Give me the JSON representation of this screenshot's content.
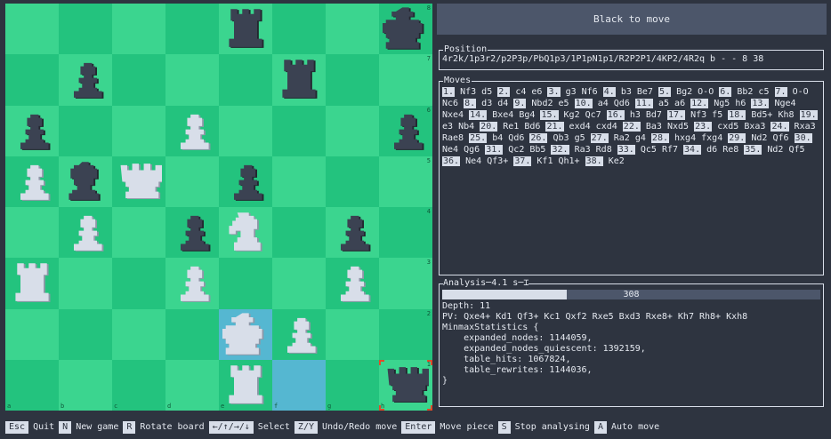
{
  "status": "Black to move",
  "position": {
    "title": "Position",
    "fen": "4r2k/1p3r2/p2P3p/PbQ1p3/1P1pN1p1/R2P2P1/4KP2/4R2q b - - 8 38"
  },
  "moves": {
    "title": "Moves",
    "list": [
      {
        "n": "1.",
        "w": "Nf3",
        "b": "d5"
      },
      {
        "n": "2.",
        "w": "c4",
        "b": "e6"
      },
      {
        "n": "3.",
        "w": "g3",
        "b": "Nf6"
      },
      {
        "n": "4.",
        "w": "b3",
        "b": "Be7"
      },
      {
        "n": "5.",
        "w": "Bg2",
        "b": "O-O"
      },
      {
        "n": "6.",
        "w": "Bb2",
        "b": "c5"
      },
      {
        "n": "7.",
        "w": "O-O",
        "b": "Nc6"
      },
      {
        "n": "8.",
        "w": "d3",
        "b": "d4"
      },
      {
        "n": "9.",
        "w": "Nbd2",
        "b": "e5"
      },
      {
        "n": "10.",
        "w": "a4",
        "b": "Qd6"
      },
      {
        "n": "11.",
        "w": "a5",
        "b": "a6"
      },
      {
        "n": "12.",
        "w": "Ng5",
        "b": "h6"
      },
      {
        "n": "13.",
        "w": "Nge4",
        "b": "Nxe4"
      },
      {
        "n": "14.",
        "w": "Bxe4",
        "b": "Bg4"
      },
      {
        "n": "15.",
        "w": "Kg2",
        "b": "Qc7"
      },
      {
        "n": "16.",
        "w": "h3",
        "b": "Bd7"
      },
      {
        "n": "17.",
        "w": "Nf3",
        "b": "f5"
      },
      {
        "n": "18.",
        "w": "Bd5+",
        "b": "Kh8"
      },
      {
        "n": "19.",
        "w": "e3",
        "b": "Nb4"
      },
      {
        "n": "20.",
        "w": "Re1",
        "b": "Bd6"
      },
      {
        "n": "21.",
        "w": "exd4",
        "b": "cxd4"
      },
      {
        "n": "22.",
        "w": "Ba3",
        "b": "Nxd5"
      },
      {
        "n": "23.",
        "w": "cxd5",
        "b": "Bxa3"
      },
      {
        "n": "24.",
        "w": "Rxa3",
        "b": "Rae8"
      },
      {
        "n": "25.",
        "w": "b4",
        "b": "Qd6"
      },
      {
        "n": "26.",
        "w": "Qb3",
        "b": "g5"
      },
      {
        "n": "27.",
        "w": "Ra2",
        "b": "g4"
      },
      {
        "n": "28.",
        "w": "hxg4",
        "b": "fxg4"
      },
      {
        "n": "29.",
        "w": "Nd2",
        "b": "Qf6"
      },
      {
        "n": "30.",
        "w": "Ne4",
        "b": "Qg6"
      },
      {
        "n": "31.",
        "w": "Qc2",
        "b": "Bb5"
      },
      {
        "n": "32.",
        "w": "Ra3",
        "b": "Rd8"
      },
      {
        "n": "33.",
        "w": "Qc5",
        "b": "Rf7"
      },
      {
        "n": "34.",
        "w": "d6",
        "b": "Re8"
      },
      {
        "n": "35.",
        "w": "Nd2",
        "b": "Qf5"
      },
      {
        "n": "36.",
        "w": "Ne4",
        "b": "Qf3+"
      },
      {
        "n": "37.",
        "w": "Kf1",
        "b": "Qh1+"
      },
      {
        "n": "38.",
        "w": "Ke2",
        "b": ""
      }
    ]
  },
  "analysis": {
    "title": "Analysis",
    "time": "4.1 s",
    "progress_label": "308",
    "progress_fraction": 0.33,
    "lines": [
      "Depth: 11",
      "PV: Qxe4+ Kd1 Qf3+ Kc1 Qxf2 Rxe5 Bxd3 Rxe8+ Kh7 Rh8+ Kxh8",
      "MinmaxStatistics {",
      "    expanded_nodes: 1144059,",
      "    expanded_nodes_quiescent: 1392159,",
      "    table_hits: 1067824,",
      "    table_rewrites: 1144036,",
      "}"
    ]
  },
  "board": {
    "orientation": "white-bottom",
    "files": [
      "a",
      "b",
      "c",
      "d",
      "e",
      "f",
      "g",
      "h"
    ],
    "ranks": [
      "1",
      "2",
      "3",
      "4",
      "5",
      "6",
      "7",
      "8"
    ],
    "pieces": [
      {
        "sq": "e8",
        "c": "b",
        "t": "rook"
      },
      {
        "sq": "h8",
        "c": "b",
        "t": "king"
      },
      {
        "sq": "b7",
        "c": "b",
        "t": "pawn"
      },
      {
        "sq": "f7",
        "c": "b",
        "t": "rook"
      },
      {
        "sq": "a6",
        "c": "b",
        "t": "pawn"
      },
      {
        "sq": "d6",
        "c": "w",
        "t": "pawn"
      },
      {
        "sq": "h6",
        "c": "b",
        "t": "pawn"
      },
      {
        "sq": "a5",
        "c": "w",
        "t": "pawn"
      },
      {
        "sq": "b5",
        "c": "b",
        "t": "bishop"
      },
      {
        "sq": "c5",
        "c": "w",
        "t": "queen"
      },
      {
        "sq": "e5",
        "c": "b",
        "t": "pawn"
      },
      {
        "sq": "b4",
        "c": "w",
        "t": "pawn"
      },
      {
        "sq": "d4",
        "c": "b",
        "t": "pawn"
      },
      {
        "sq": "e4",
        "c": "w",
        "t": "knight"
      },
      {
        "sq": "g4",
        "c": "b",
        "t": "pawn"
      },
      {
        "sq": "a3",
        "c": "w",
        "t": "rook"
      },
      {
        "sq": "d3",
        "c": "w",
        "t": "pawn"
      },
      {
        "sq": "g3",
        "c": "w",
        "t": "pawn"
      },
      {
        "sq": "e2",
        "c": "w",
        "t": "king"
      },
      {
        "sq": "f2",
        "c": "w",
        "t": "pawn"
      },
      {
        "sq": "e1",
        "c": "w",
        "t": "rook"
      },
      {
        "sq": "h1",
        "c": "b",
        "t": "queen"
      }
    ],
    "highlighted": [
      "e2",
      "f1"
    ],
    "selected": "h1",
    "colors": {
      "light": "#3bd58f",
      "dark": "#23c37e",
      "highlight": "#55b7d1",
      "white_piece": "#d8dee9",
      "black_piece": "#3b4252",
      "selection": "#e04b2a"
    }
  },
  "help": [
    {
      "key": "Esc",
      "desc": "Quit"
    },
    {
      "key": "N",
      "desc": "New game"
    },
    {
      "key": "R",
      "desc": "Rotate board"
    },
    {
      "key": "←/↑/→/↓",
      "desc": "Select"
    },
    {
      "key": "Z/Y",
      "desc": "Undo/Redo move"
    },
    {
      "key": "Enter",
      "desc": "Move piece"
    },
    {
      "key": "S",
      "desc": "Stop analysing"
    },
    {
      "key": "A",
      "desc": "Auto move"
    }
  ]
}
